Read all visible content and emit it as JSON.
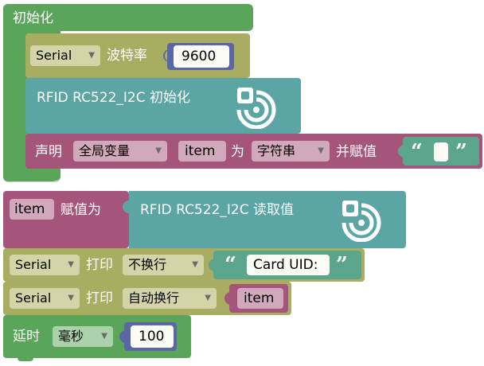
{
  "colors": {
    "control": "#5ba55b",
    "serial": "#a9ad62",
    "rfid": "#5ba5a5",
    "variable": "#a5547a",
    "text": "#5ba58c",
    "math": "#5b67a5"
  },
  "setup": {
    "title": "初始化",
    "serial_begin": {
      "port": "Serial",
      "label": "波特率",
      "baud": "9600"
    },
    "rfid_init": {
      "label": "RFID RC522_I2C 初始化",
      "icon": "rfid-icon"
    },
    "declare": {
      "label": "声明",
      "scope": "全局变量",
      "name": "item",
      "as": "为",
      "type": "字符串",
      "assign": "并赋值",
      "open_quote": "“",
      "close_quote": "”",
      "value": ""
    }
  },
  "loop": {
    "assign": {
      "var": "item",
      "label": "赋值为",
      "source": "RFID RC522_I2C 读取值",
      "icon": "rfid-icon"
    },
    "print1": {
      "port": "Serial",
      "label": "打印",
      "mode": "不换行",
      "open_quote": "“",
      "text": "Card UID:",
      "close_quote": "”"
    },
    "print2": {
      "port": "Serial",
      "label": "打印",
      "mode": "自动换行",
      "var": "item"
    },
    "delay": {
      "label": "延时",
      "unit": "毫秒",
      "value": "100"
    }
  }
}
